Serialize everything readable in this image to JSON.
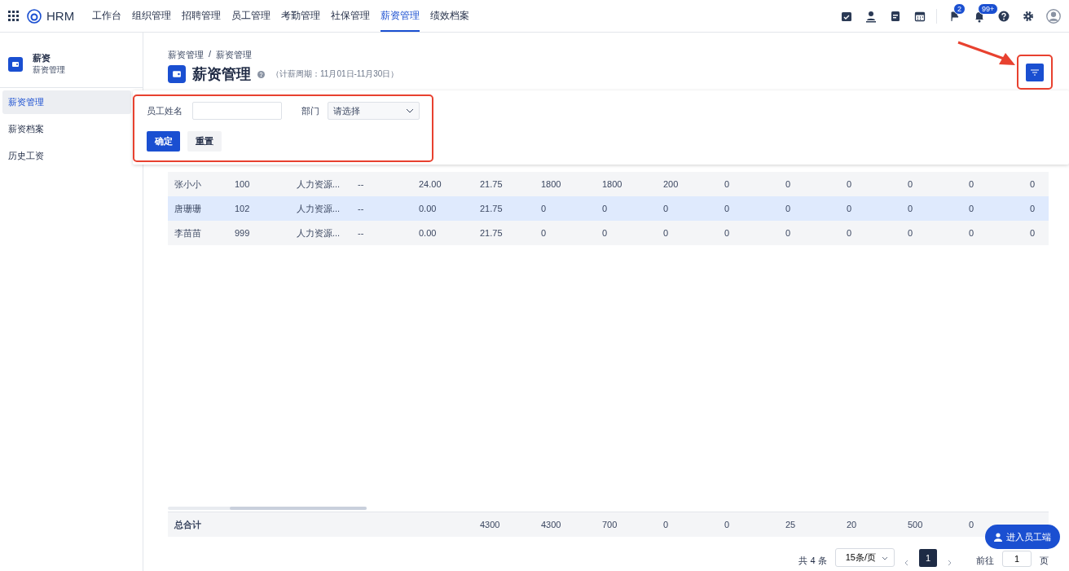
{
  "nav": {
    "app_name": "HRM",
    "items": [
      {
        "label": "工作台",
        "selected": false
      },
      {
        "label": "组织管理",
        "selected": false
      },
      {
        "label": "招聘管理",
        "selected": false
      },
      {
        "label": "员工管理",
        "selected": false
      },
      {
        "label": "考勤管理",
        "selected": false
      },
      {
        "label": "社保管理",
        "selected": false
      },
      {
        "label": "薪资管理",
        "selected": true
      },
      {
        "label": "绩效档案",
        "selected": false
      }
    ],
    "flag_badge": "2",
    "bell_badge": "99+"
  },
  "sidebar": {
    "title": "薪资",
    "subtitle": "薪资管理",
    "items": [
      {
        "label": "薪资管理",
        "selected": true
      },
      {
        "label": "薪资档案",
        "selected": false
      },
      {
        "label": "历史工资",
        "selected": false
      }
    ]
  },
  "page": {
    "breadcrumb": [
      "薪资管理",
      "薪资管理"
    ],
    "breadcrumb_separator": "/",
    "title": "薪资管理",
    "period": "（计薪周期：11月01日-11月30日）"
  },
  "filter": {
    "name_label": "员工姓名",
    "dept_label": "部门",
    "dept_placeholder": "请选择",
    "confirm": "确定",
    "reset": "重置"
  },
  "table": {
    "rows": [
      {
        "selected": false,
        "cells": [
          "张小小",
          "100",
          "人力资源...",
          "--",
          "24.00",
          "21.75",
          "1800",
          "1800",
          "200",
          "0",
          "0",
          "0",
          "0",
          "0",
          "0"
        ]
      },
      {
        "selected": true,
        "cells": [
          "唐珊珊",
          "102",
          "人力资源...",
          "--",
          "0.00",
          "21.75",
          "0",
          "0",
          "0",
          "0",
          "0",
          "0",
          "0",
          "0",
          "0"
        ]
      },
      {
        "selected": false,
        "cells": [
          "李苗苗",
          "999",
          "人力资源...",
          "--",
          "0.00",
          "21.75",
          "0",
          "0",
          "0",
          "0",
          "0",
          "0",
          "0",
          "0",
          "0"
        ]
      }
    ],
    "total_label": "总合计",
    "totals": [
      "4300",
      "4300",
      "700",
      "0",
      "0",
      "25",
      "20",
      "500",
      "0"
    ]
  },
  "pagination": {
    "total": "共 4 条",
    "page_size": "15条/页",
    "pages": [
      {
        "label": "1",
        "selected": true
      }
    ],
    "goto_label": "前往",
    "goto_value": "1",
    "goto_suffix": "页"
  },
  "float_button": "进入员工端"
}
